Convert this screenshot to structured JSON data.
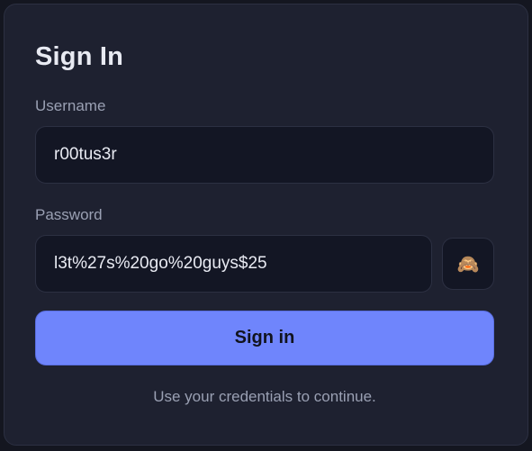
{
  "form": {
    "title": "Sign In",
    "username_label": "Username",
    "username_value": "r00tus3r",
    "password_label": "Password",
    "password_value": "l3t%27s%20go%20guys$25",
    "toggle_icon": "🙈",
    "submit_label": "Sign in",
    "hint": "Use your credentials to continue."
  },
  "colors": {
    "background": "#141620",
    "card": "#1e2130",
    "input_bg": "#131624",
    "accent": "#6f85fc"
  }
}
